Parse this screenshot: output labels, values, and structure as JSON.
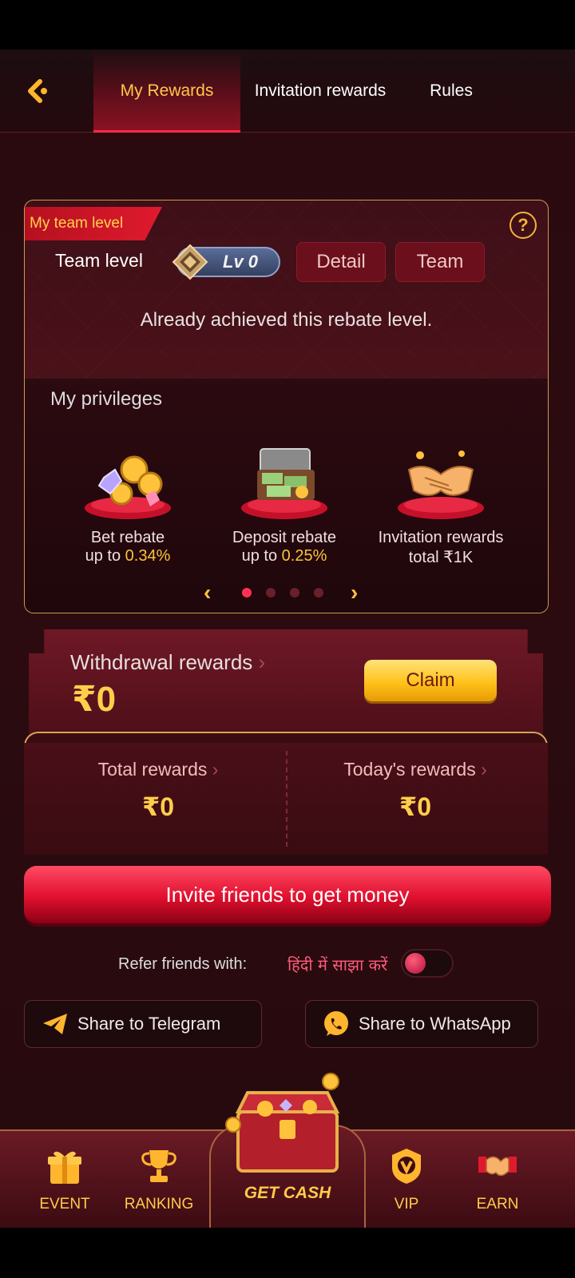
{
  "header": {
    "tabs": [
      {
        "label": "My Rewards",
        "active": true
      },
      {
        "label": "Invitation rewards",
        "active": false
      },
      {
        "label": "Rules",
        "active": false
      }
    ]
  },
  "team": {
    "ribbon": "My team level",
    "level_label": "Team level",
    "level_badge": "Lv 0",
    "detail_button": "Detail",
    "team_button": "Team",
    "status": "Already achieved this rebate level."
  },
  "privileges": {
    "title": "My privileges",
    "items": [
      {
        "line1": "Bet rebate",
        "prefix": "up to ",
        "value": "0.34%"
      },
      {
        "line1": "Deposit rebate",
        "prefix": "up to ",
        "value": "0.25%"
      },
      {
        "line1": "Invitation rewards",
        "prefix": "total ",
        "value": "₹1K"
      }
    ],
    "page_count": 4,
    "active_page": 1
  },
  "withdrawal": {
    "title": "Withdrawal rewards",
    "amount": "₹0",
    "claim_label": "Claim"
  },
  "rewards": {
    "total_label": "Total rewards",
    "total_value": "₹0",
    "today_label": "Today's rewards",
    "today_value": "₹0"
  },
  "invite_button": "Invite friends to get money",
  "refer": {
    "label": "Refer friends with:",
    "language": "हिंदी में साझा करें",
    "toggle_on": false
  },
  "share": {
    "telegram": "Share to Telegram",
    "whatsapp": "Share to WhatsApp"
  },
  "nav": {
    "event": "EVENT",
    "ranking": "RANKING",
    "get_cash": "GET CASH",
    "vip": "VIP",
    "earn": "EARN"
  },
  "colors": {
    "accent_gold": "#ffcb4a",
    "accent_red": "#e0102e",
    "background": "#2a0a0f"
  }
}
